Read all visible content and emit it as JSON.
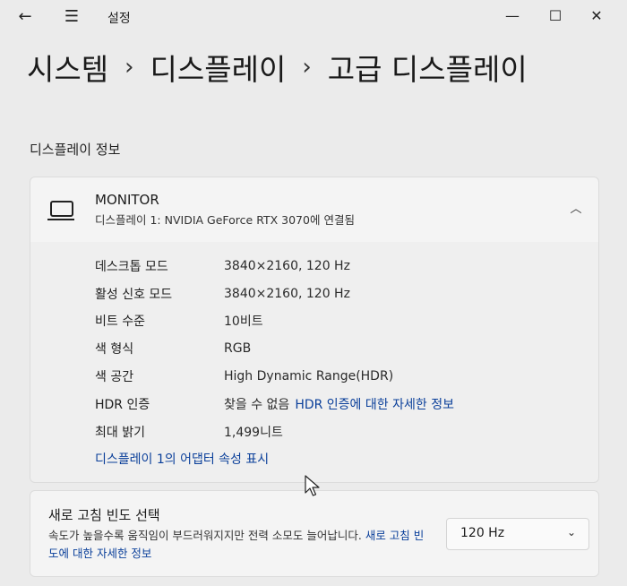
{
  "window": {
    "title": "설정",
    "back_icon": "←",
    "menu_icon": "☰",
    "minimize_icon": "—",
    "maximize_icon": "☐",
    "close_icon": "✕"
  },
  "breadcrumb": {
    "items": [
      "시스템",
      "디스플레이",
      "고급 디스플레이"
    ],
    "separator": "›"
  },
  "section_title": "디스플레이 정보",
  "monitor": {
    "name": "MONITOR",
    "subtitle": "디스플레이 1: NVIDIA GeForce RTX 3070에 연결됨",
    "collapse_icon": "︿",
    "rows": [
      {
        "label": "데스크톱 모드",
        "value": "3840×2160, 120 Hz"
      },
      {
        "label": "활성 신호 모드",
        "value": "3840×2160, 120 Hz"
      },
      {
        "label": "비트 수준",
        "value": "10비트"
      },
      {
        "label": "색 형식",
        "value": "RGB"
      },
      {
        "label": "색 공간",
        "value": "High Dynamic Range(HDR)"
      },
      {
        "label": "HDR 인증",
        "value": "찾을 수 없음",
        "link": "HDR 인증에 대한 자세한 정보"
      },
      {
        "label": "최대 밝기",
        "value": "1,499니트"
      }
    ],
    "adapter_link": "디스플레이 1의 어댑터 속성 표시"
  },
  "refresh": {
    "title": "새로 고침 빈도 선택",
    "desc": "속도가 높을수록 움직임이 부드러워지지만 전력 소모도 늘어납니다.",
    "link": "새로 고침 빈도에 대한 자세한 정보",
    "selected": "120 Hz",
    "dropdown_icon": "⌄"
  },
  "colors": {
    "background": "#ebebeb",
    "card": "#f4f4f4",
    "link": "#0a3f9a"
  }
}
